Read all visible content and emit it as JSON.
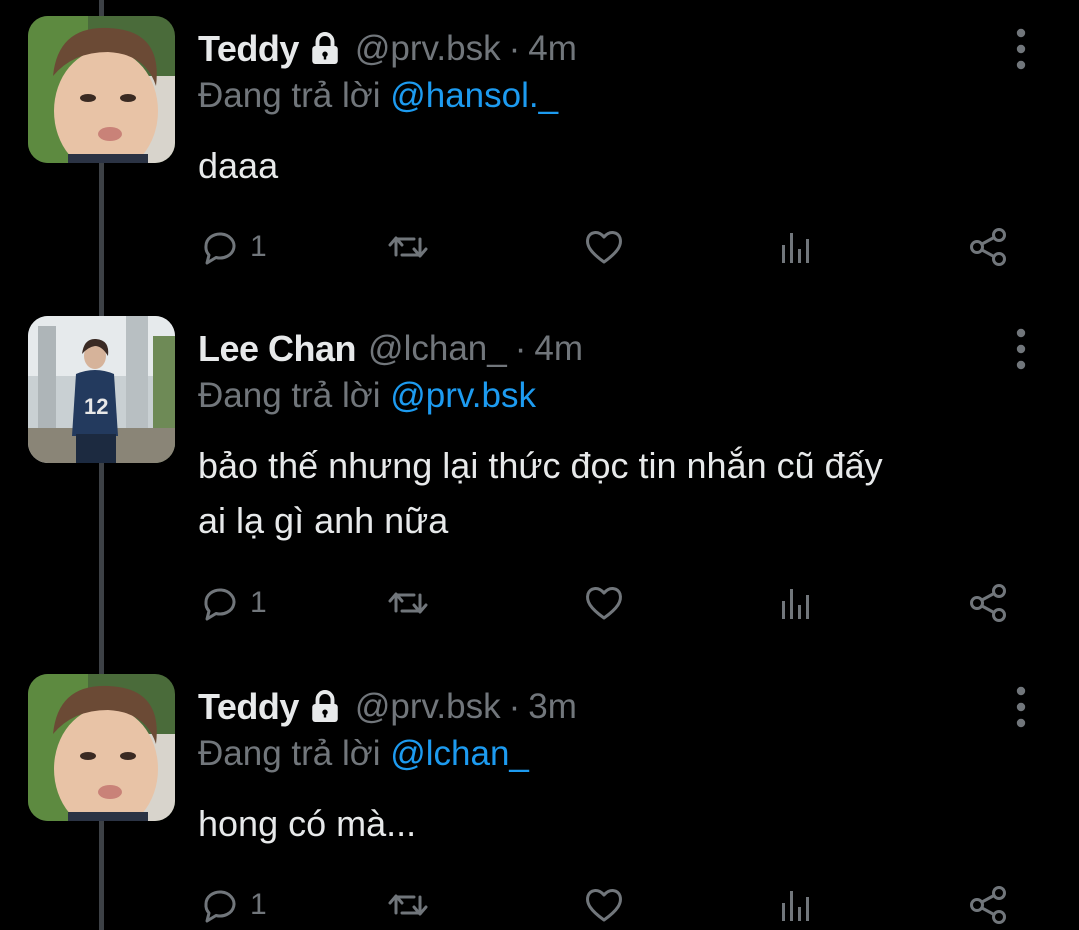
{
  "colors": {
    "background": "#000000",
    "text": "#e7e9ea",
    "muted": "#71767b",
    "mention": "#1d9bf0",
    "thread_line": "#3d4146"
  },
  "icons": [
    "lock-icon",
    "more-icon",
    "reply-icon",
    "retweet-icon",
    "like-icon",
    "views-icon",
    "share-icon"
  ],
  "tweets": [
    {
      "name": "Teddy",
      "locked": true,
      "handle": "@prv.bsk",
      "dot": "·",
      "time": "4m",
      "reply_prefix": "Đang trả lời ",
      "reply_to": "@hansol._",
      "text": "daaa",
      "reply_count": "1"
    },
    {
      "name": "Lee Chan",
      "locked": false,
      "handle": "@lchan_",
      "dot": "·",
      "time": "4m",
      "reply_prefix": "Đang trả lời ",
      "reply_to": "@prv.bsk",
      "text": "bảo thế nhưng lại thức đọc tin nhắn cũ đấy\nai lạ gì anh nữa",
      "reply_count": "1"
    },
    {
      "name": "Teddy",
      "locked": true,
      "handle": "@prv.bsk",
      "dot": "·",
      "time": "3m",
      "reply_prefix": "Đang trả lời ",
      "reply_to": "@lchan_",
      "text": "hong có mà...",
      "reply_count": "1"
    }
  ]
}
